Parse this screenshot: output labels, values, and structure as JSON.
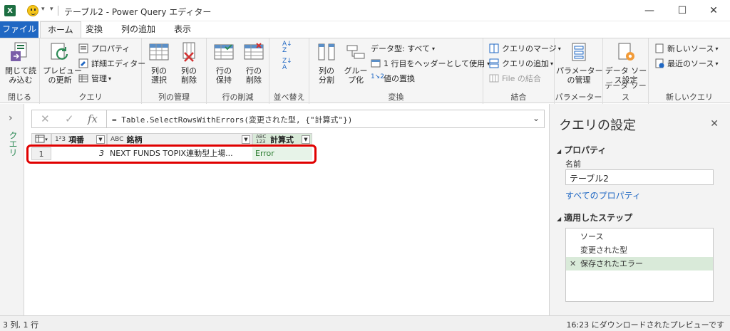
{
  "window": {
    "app_icon": "X",
    "title": "テーブル2 - Power Query エディター",
    "minimize": "—",
    "maximize": "☐",
    "close": "✕"
  },
  "tabs": [
    {
      "label": "ファイル"
    },
    {
      "label": "ホーム"
    },
    {
      "label": "変換"
    },
    {
      "label": "列の追加"
    },
    {
      "label": "表示"
    }
  ],
  "ribbon": {
    "close_load": "閉じて読\nみ込む",
    "group_close": "閉じる",
    "preview_refresh": "プレビュー\nの更新",
    "properties": "プロパティ",
    "advanced_editor": "詳細エディター",
    "manage": "管理",
    "group_query": "クエリ",
    "choose_columns": "列の\n選択",
    "remove_columns": "列の\n削除",
    "group_manage_columns": "列の管理",
    "keep_rows": "行の\n保持",
    "remove_rows": "行の\n削除",
    "group_reduce_rows": "行の削減",
    "group_sort": "並べ替え",
    "split_column": "列の\n分割",
    "group_by": "グルー\nプ化",
    "data_type": "データ型: すべて",
    "use_first_row": "1 行目をヘッダーとして使用",
    "replace_values": "値の置換",
    "group_transform": "変換",
    "merge_queries": "クエリのマージ",
    "append_queries": "クエリの追加",
    "combine_files": "File の結合",
    "group_combine": "結合",
    "manage_params": "パラメーター\nの管理",
    "group_params": "パラメーター",
    "data_source_settings": "データ ソー\nス設定",
    "group_data_sources": "データ ソース",
    "new_source": "新しいソース",
    "recent_sources": "最近のソース",
    "group_new_query": "新しいクエリ"
  },
  "left_pane": {
    "label": "クエリ"
  },
  "formula_bar": {
    "cancel": "✕",
    "ok": "✓",
    "fx": "fx",
    "formula": "= Table.SelectRowsWithErrors(変更された型, {\"計算式\"})"
  },
  "grid": {
    "columns": [
      {
        "type_icon": "1²3",
        "name": "項番"
      },
      {
        "type_icon": "ABC",
        "name": "銘柄"
      },
      {
        "type_icon": "ABC 123",
        "name": "計算式"
      }
    ],
    "rows": [
      {
        "row_number": "1",
        "values": [
          "3",
          "NEXT FUNDS TOPIX連動型上場...",
          "Error"
        ]
      }
    ]
  },
  "query_settings": {
    "title": "クエリの設定",
    "properties_header": "プロパティ",
    "name_label": "名前",
    "name_value": "テーブル2",
    "all_properties": "すべてのプロパティ",
    "applied_steps_header": "適用したステップ",
    "steps": [
      "ソース",
      "変更された型",
      "保存されたエラー"
    ]
  },
  "status": {
    "left": "3 列, 1 行",
    "right": "16:23 にダウンロードされたプレビューです"
  },
  "colors": {
    "accent": "#1f67c3",
    "excel_green": "#1d6f42",
    "highlight_box": "#e00000",
    "active_step": "#d9ead9"
  }
}
